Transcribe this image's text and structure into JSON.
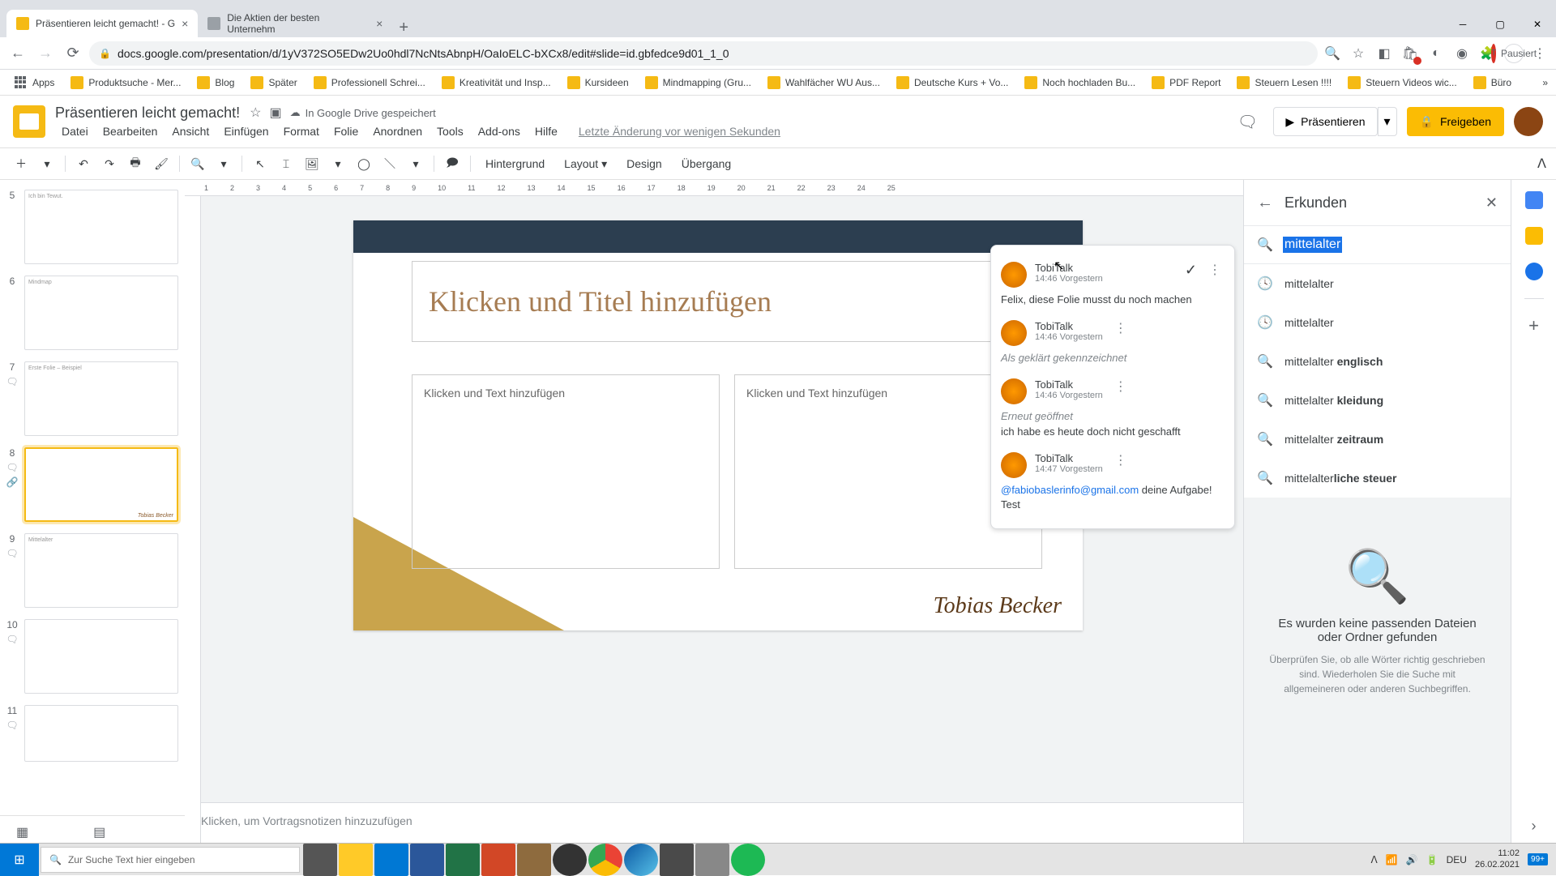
{
  "chrome": {
    "tabs": [
      {
        "title": "Präsentieren leicht gemacht! - G",
        "active": true
      },
      {
        "title": "Die Aktien der besten Unternehm",
        "active": false
      }
    ],
    "url": "docs.google.com/presentation/d/1yV372SO5EDw2Uo0hdl7NcNtsAbnpH/OaIoELC-bXCx8/edit#slide=id.gbfedce9d01_1_0",
    "pause": "Pausiert"
  },
  "bookmarks": [
    "Apps",
    "Produktsuche - Mer...",
    "Blog",
    "Später",
    "Professionell Schrei...",
    "Kreativität und Insp...",
    "Kursideen",
    "Mindmapping  (Gru...",
    "Wahlfächer WU Aus...",
    "Deutsche Kurs + Vo...",
    "Noch hochladen Bu...",
    "PDF Report",
    "Steuern Lesen !!!!",
    "Steuern Videos wic...",
    "Büro"
  ],
  "doc": {
    "title": "Präsentieren leicht gemacht!",
    "save_status": "In Google Drive gespeichert",
    "last_edit": "Letzte Änderung vor wenigen Sekunden"
  },
  "menus": [
    "Datei",
    "Bearbeiten",
    "Ansicht",
    "Einfügen",
    "Format",
    "Folie",
    "Anordnen",
    "Tools",
    "Add-ons",
    "Hilfe"
  ],
  "header_buttons": {
    "present": "Präsentieren",
    "share": "Freigeben"
  },
  "toolbar": {
    "bg": "Hintergrund",
    "layout": "Layout",
    "design": "Design",
    "transition": "Übergang"
  },
  "filmstrip": [
    {
      "n": "5",
      "label": "Ich bin Tewut."
    },
    {
      "n": "6",
      "label": "Mindmap"
    },
    {
      "n": "7",
      "label": "Erste Folie – Beispiel"
    },
    {
      "n": "8",
      "label": "",
      "active": true
    },
    {
      "n": "9",
      "label": "Mittelalter"
    },
    {
      "n": "10",
      "label": ""
    },
    {
      "n": "11",
      "label": ""
    }
  ],
  "slide": {
    "title_ph": "Klicken und Titel hinzufügen",
    "body_ph_l": "Klicken und Text hinzufügen",
    "body_ph_r": "Klicken und Text hinzufügen",
    "signature": "Tobias Becker"
  },
  "notes_ph": "Klicken, um Vortragsnotizen hinzuzufügen",
  "comments": [
    {
      "author": "TobiTalk",
      "time": "14:46 Vorgestern",
      "body": "Felix, diese Folie musst du noch machen",
      "check": true
    },
    {
      "author": "TobiTalk",
      "time": "14:46 Vorgestern",
      "body_em": "Als geklärt gekennzeichnet"
    },
    {
      "author": "TobiTalk",
      "time": "14:46 Vorgestern",
      "body_em": "Erneut geöffnet",
      "body": "ich habe es heute doch nicht geschafft"
    },
    {
      "author": "TobiTalk",
      "time": "14:47 Vorgestern",
      "mention": "@fabiobaslerinfo@gmail.com",
      "body": " deine Aufgabe! Test"
    }
  ],
  "explore": {
    "title": "Erkunden",
    "query": "mittelalter",
    "suggestions": [
      {
        "icon": "history",
        "text": "mittelalter"
      },
      {
        "icon": "history",
        "text": "mittelalter"
      },
      {
        "icon": "search",
        "prefix": "mittelalter ",
        "bold": "englisch"
      },
      {
        "icon": "search",
        "prefix": "mittelalter ",
        "bold": "kleidung"
      },
      {
        "icon": "search",
        "prefix": "mittelalter ",
        "bold": "zeitraum"
      },
      {
        "icon": "search",
        "prefix": "mittelalter",
        "bold": "liche steuer"
      }
    ],
    "empty_title": "Es wurden keine passenden Dateien oder Ordner gefunden",
    "empty_sub": "Überprüfen Sie, ob alle Wörter richtig geschrieben sind. Wiederholen Sie die Suche mit allgemeineren oder anderen Suchbegriffen."
  },
  "taskbar": {
    "search_ph": "Zur Suche Text hier eingeben",
    "lang": "DEU",
    "time": "11:02",
    "date": "26.02.2021",
    "notif": "99+"
  },
  "ruler": [
    1,
    2,
    3,
    4,
    5,
    6,
    7,
    8,
    9,
    10,
    11,
    12,
    13,
    14,
    15,
    16,
    17,
    18,
    19,
    20,
    21,
    22,
    23,
    24,
    25
  ]
}
